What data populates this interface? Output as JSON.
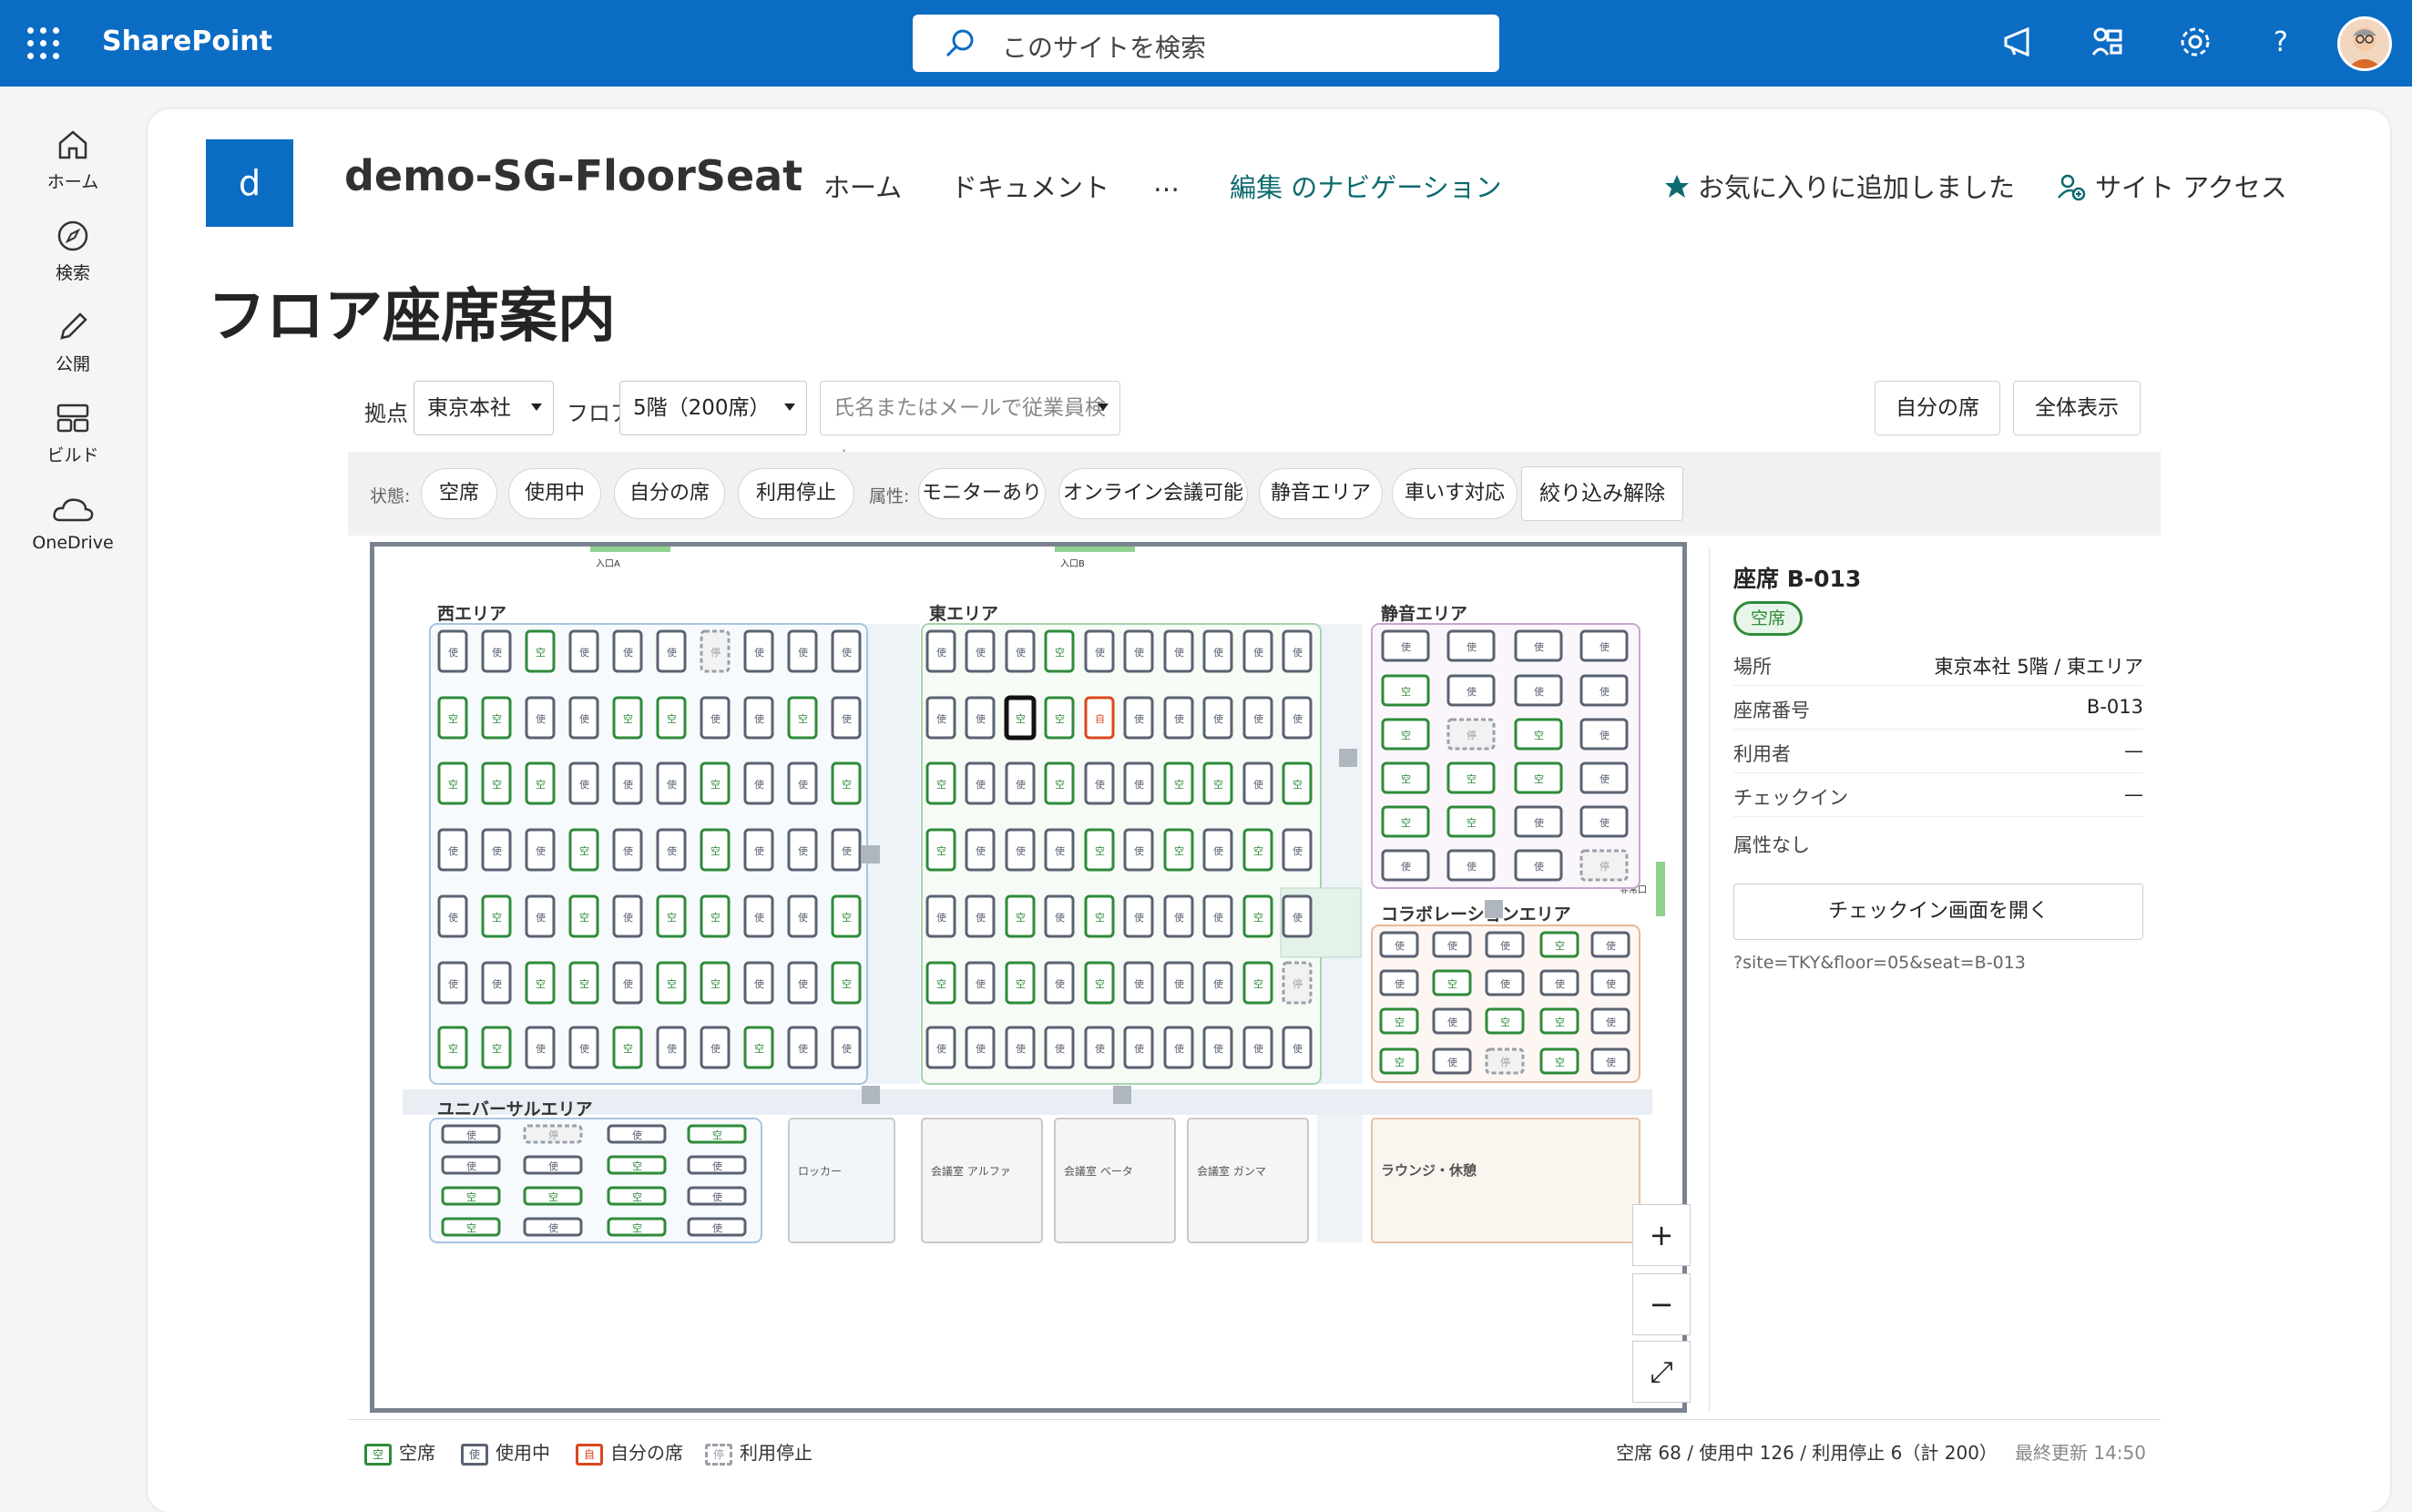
{
  "suite": {
    "brand": "SharePoint",
    "search_placeholder": "このサイトを検索",
    "icons": [
      "waffle-icon",
      "megaphone-icon",
      "share-icon",
      "gear-icon",
      "help-icon"
    ]
  },
  "rail": [
    {
      "label": "ホーム",
      "icon": "home-icon"
    },
    {
      "label": "検索",
      "icon": "compass-icon"
    },
    {
      "label": "公開",
      "icon": "pencil-icon"
    },
    {
      "label": "ビルド",
      "icon": "layout-icon"
    },
    {
      "label": "OneDrive",
      "icon": "cloud-icon"
    }
  ],
  "site": {
    "logo_letter": "d",
    "name": "demo-SG-FloorSeat",
    "nav": [
      "ホーム",
      "ドキュメント",
      "…",
      "編集 のナビゲーション"
    ],
    "favorite": "お気に入りに追加しました",
    "access": "サイト アクセス"
  },
  "page_title": "フロア座席案内",
  "toolbar": {
    "site_label": "拠点",
    "site_value": "東京本社",
    "floor_label": "フロア",
    "floor_value": "5階（200席）",
    "search_placeholder": "氏名またはメールで従業員検索",
    "my_seat": "自分の席",
    "show_all": "全体表示"
  },
  "filters": {
    "state_label": "状態:",
    "state_chips": [
      "空席",
      "使用中",
      "自分の席",
      "利用停止"
    ],
    "attr_label": "属性:",
    "attr_chips": [
      "モニターあり",
      "オンライン会議可能",
      "静音エリア",
      "車いす対応"
    ],
    "clear": "絞り込み解除"
  },
  "map": {
    "entrances": [
      "入口A",
      "入口B"
    ],
    "emergency_exit": "非常口",
    "areas": {
      "west": "西エリア",
      "east": "東エリア",
      "quiet": "静音エリア",
      "collab": "コラボレーションエリア",
      "universal": "ユニバーサルエリア"
    },
    "rooms": [
      "ロッカー",
      "会議室 アルファ",
      "会議室 ベータ",
      "会議室 ガンマ",
      "ラウンジ・休憩"
    ],
    "seat_glyphs": {
      "vacant": "空",
      "used": "使",
      "mine": "自",
      "stopped": "停"
    },
    "colors": {
      "vacant": "#2e8b3a",
      "used": "#5a6272",
      "mine": "#d9481c",
      "stopped": "#9aa0a8",
      "selected": "#111111"
    },
    "zoom": [
      "+",
      "−",
      "⤢"
    ]
  },
  "detail": {
    "title": "座席 B-013",
    "status": "空席",
    "rows": [
      {
        "k": "場所",
        "v": "東京本社 5階 / 東エリア"
      },
      {
        "k": "座席番号",
        "v": "B-013"
      },
      {
        "k": "利用者",
        "v": "—"
      },
      {
        "k": "チェックイン",
        "v": "—"
      }
    ],
    "no_attr": "属性なし",
    "open_checkin": "チェックイン画面を開く",
    "query": "?site=TKY&floor=05&seat=B-013"
  },
  "legend": [
    {
      "label": "空席",
      "glyph": "空"
    },
    {
      "label": "使用中",
      "glyph": "使"
    },
    {
      "label": "自分の席",
      "glyph": "自"
    },
    {
      "label": "利用停止",
      "glyph": "停"
    }
  ],
  "summary": "空席 68 / 使用中 126 / 利用停止 6（計 200）",
  "updated": "最終更新 14:50"
}
